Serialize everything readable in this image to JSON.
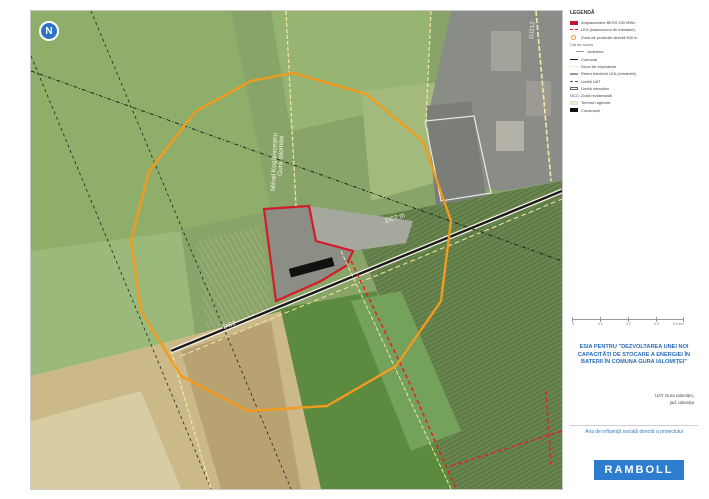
{
  "map": {
    "labels": {
      "road_vertical": "Gura Ialomiței",
      "road_vertical_2": "Mihail Kogălniceanu",
      "dc_road_right": "DC7 m",
      "dc_road_left": "DC2",
      "county_road": "DJ212"
    },
    "north_symbol": "N"
  },
  "legend": {
    "title": "LEGENDĂ",
    "items": [
      {
        "swatch": "red-fill",
        "label": "Amplasament BESS 200 MWh",
        "style": "normal"
      },
      {
        "swatch": "red-dash",
        "label": "LEA (traseu/zona de instalare)",
        "style": "normal"
      },
      {
        "swatch": "orange-circle",
        "label": "Zona de protecție directă 500 m",
        "style": "normal"
      },
      {
        "swatch": "none",
        "label": "Căi de acces",
        "style": "head"
      },
      {
        "swatch": "thin-line",
        "label": "Județene",
        "style": "sub"
      },
      {
        "swatch": "road",
        "label": "Comunal",
        "style": "normal"
      },
      {
        "swatch": "cream-dash",
        "label": "Drum de exploatare",
        "style": "normal"
      },
      {
        "swatch": "rail",
        "label": "Rețea electrică LEA (existentă)",
        "style": "normal"
      },
      {
        "swatch": "uat",
        "label": "Limită UAT",
        "style": "normal"
      },
      {
        "swatch": "intravilan",
        "label": "Limită intravilan",
        "style": "normal"
      },
      {
        "swatch": "none",
        "label": "OCC: Zonă rezidențială",
        "style": "normal"
      },
      {
        "swatch": "agri",
        "label": "Terenuri agricole",
        "style": "normal"
      },
      {
        "swatch": "building",
        "label": "Construcții",
        "style": "normal"
      }
    ]
  },
  "scale": {
    "ticks": [
      "0",
      "0.1",
      "0.2",
      "0.3",
      "0.4 km"
    ]
  },
  "project": {
    "title_lines": [
      "ESIA PENTRU \"DEZVOLTAREA UNEI NOI",
      "CAPACITĂȚI DE STOCARE A ENERGIEI ÎN",
      "BATERII ÎN COMUNA GURA IALOMIȚEI\""
    ],
    "location_lines": [
      "UAT Gura Ialomiței,",
      "jud. Ialomița"
    ],
    "caption": "Aria de influență socială directă a proiectului"
  },
  "brand": {
    "logo": "RAMBOLL",
    "color": "#2e7ccd"
  },
  "colors": {
    "site_outline": "#d41b2c",
    "buffer": "#f29b1d",
    "lea_line": "#e0232b",
    "road": "#1a1a1a",
    "farm_track": "#f4e9a2"
  }
}
